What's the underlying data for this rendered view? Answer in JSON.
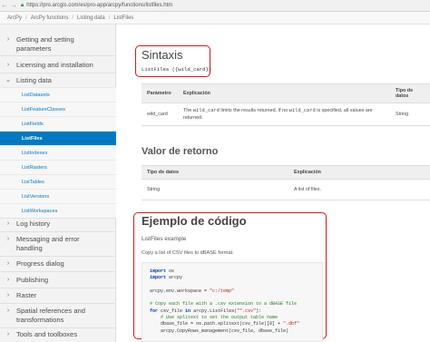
{
  "browser": {
    "url": "https://pro.arcgis.com/es/pro-app/arcpy/functions/listfiles.htm",
    "back_icon": "back-arrow-icon",
    "forward_icon": "forward-arrow-icon",
    "secure_icon": "lock-icon"
  },
  "breadcrumb": [
    "ArcPy",
    "ArcPy functions",
    "Listing data",
    "ListFiles"
  ],
  "sidebar": {
    "items": [
      {
        "label_lines": [
          "Getting and setting",
          "parameters"
        ],
        "chevron": "›"
      },
      {
        "label_lines": [
          "Licensing and installation"
        ],
        "chevron": "›"
      },
      {
        "label_lines": [
          "Listing data"
        ],
        "chevron": "⌄"
      },
      {
        "label_lines": [
          "Log history"
        ],
        "chevron": "›"
      },
      {
        "label_lines": [
          "Messaging and error",
          "handling"
        ],
        "chevron": "›"
      },
      {
        "label_lines": [
          "Progress dialog"
        ],
        "chevron": "›"
      },
      {
        "label_lines": [
          "Publishing"
        ],
        "chevron": "›"
      },
      {
        "label_lines": [
          "Raster"
        ],
        "chevron": "›"
      },
      {
        "label_lines": [
          "Spatial references and",
          "transformations"
        ],
        "chevron": "›"
      },
      {
        "label_lines": [
          "Tools and toolboxes"
        ],
        "chevron": "›"
      }
    ],
    "sub_items": [
      "ListDatasets",
      "ListFeatureClasses",
      "ListFields",
      "ListFiles",
      "ListIndexes",
      "ListRasters",
      "ListTables",
      "ListVersions",
      "ListWorkspaces"
    ],
    "active_sub": "ListFiles"
  },
  "content": {
    "syntax_heading": "Sintaxis",
    "syntax_code": "ListFiles ({wild_card})",
    "params_table": {
      "headers": [
        "Parámetro",
        "Explicación",
        "Tipo de datos"
      ],
      "row": {
        "param": "wild_card",
        "expl_part1": "The ",
        "expl_code1": "wild_card",
        "expl_part2": " limits the results returned. If no ",
        "expl_code2": "wild_card",
        "expl_part3": " is specified, all values are returned.",
        "type": "String"
      }
    },
    "return_heading": "Valor de retorno",
    "return_table": {
      "headers": [
        "Tipo de datos",
        "Explicación"
      ],
      "row": {
        "type": "String",
        "expl": "A list of files."
      }
    },
    "example_heading": "Ejemplo de código",
    "example_title": "ListFiles example",
    "example_desc": "Copy a list of CSV files to dBASE format.",
    "code_lines": [
      "import os",
      "import arcpy",
      "",
      "arcpy.env.workspace = \"c:/temp\"",
      "",
      "# Copy each file with a .csv extension to a dBASE file",
      "for csv_file in arcpy.ListFiles(\"*.csv\"):",
      "    # Use splitext to set the output table name",
      "    dbase_file = os.path.splitext(csv_file)[0] + \".dbf\"",
      "    arcpy.CopyRows_management(csv_file, dbase_file)"
    ]
  },
  "colors": {
    "accent_blue": "#0079c1",
    "highlight_red": "#d0191b",
    "sidebar_bg": "#f3f3f3"
  }
}
